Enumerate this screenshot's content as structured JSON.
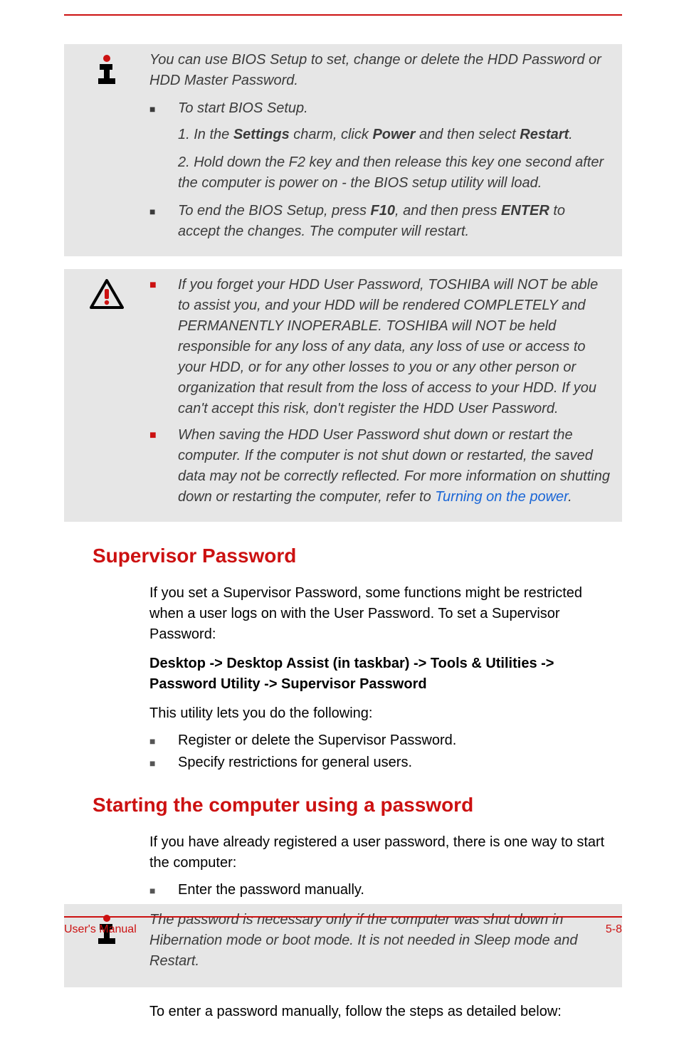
{
  "note1": {
    "intro": "You can use BIOS Setup to set, change or delete the HDD Password or HDD Master Password.",
    "bullet1": "To start BIOS Setup.",
    "step1_pre": "1. In the ",
    "step1_b1": "Settings",
    "step1_mid1": " charm, click ",
    "step1_b2": "Power",
    "step1_mid2": " and then select ",
    "step1_b3": "Restart",
    "step1_end": ".",
    "step2": "2. Hold down the F2 key and then release this key one second after the computer is power on - the BIOS setup utility will load.",
    "bullet2_pre": "To end the BIOS Setup, press ",
    "bullet2_b1": "F10",
    "bullet2_mid": ", and then press ",
    "bullet2_b2": "ENTER",
    "bullet2_end": " to accept the changes. The computer will restart."
  },
  "warn": {
    "b1": "If you forget your HDD User Password, TOSHIBA will NOT be able to assist you, and your HDD will be rendered COMPLETELY and PERMANENTLY INOPERABLE. TOSHIBA will NOT be held responsible for any loss of any data, any loss of use or access to your HDD, or for any other losses to you or any other person or organization that result from the loss of access to your HDD. If you can't accept this risk, don't register the HDD User Password.",
    "b2_pre": "When saving the HDD User Password shut down or restart the computer. If the computer is not shut down or restarted, the saved data may not be correctly reflected. For more information on shutting down or restarting the computer, refer to ",
    "b2_link": "Turning on the power",
    "b2_end": "."
  },
  "sup": {
    "heading": "Supervisor Password",
    "p1": "If you set a Supervisor Password, some functions might be restricted when a user logs on with the User Password. To set a Supervisor Password:",
    "path": "Desktop -> Desktop Assist (in taskbar) -> Tools & Utilities -> Password Utility -> Supervisor Password",
    "p2": "This utility lets you do the following:",
    "li1": "Register or delete the Supervisor Password.",
    "li2": "Specify restrictions for general users."
  },
  "start": {
    "heading": "Starting the computer using a password",
    "p1": "If you have already registered a user password, there is one way to start the computer:",
    "li1": "Enter the password manually."
  },
  "note3": {
    "text": "The password is necessary only if the computer was shut down in Hibernation mode or boot mode. It is not needed in Sleep mode and Restart."
  },
  "outro": "To enter a password manually, follow the steps as detailed below:",
  "footer": {
    "left": "User's Manual",
    "right": "5-8"
  }
}
